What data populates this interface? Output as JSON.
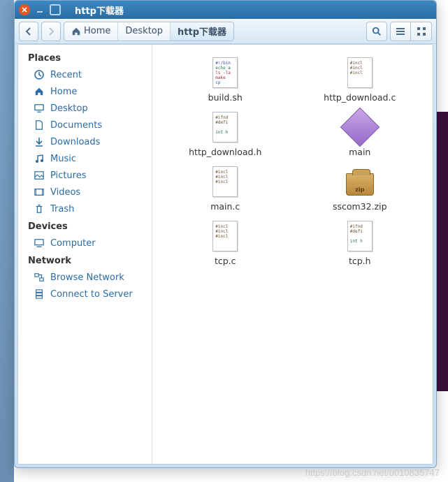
{
  "window": {
    "title": "http下载器"
  },
  "toolbar": {
    "back_tooltip": "Back",
    "forward_tooltip": "Forward",
    "breadcrumb": [
      {
        "label": "Home",
        "icon": "home"
      },
      {
        "label": "Desktop"
      },
      {
        "label": "http下载器",
        "active": true
      }
    ],
    "search_tooltip": "Search",
    "listview_tooltip": "List View",
    "iconview_tooltip": "Icon View"
  },
  "sidebar": {
    "sections": [
      {
        "heading": "Places",
        "items": [
          {
            "label": "Recent",
            "icon": "clock"
          },
          {
            "label": "Home",
            "icon": "home"
          },
          {
            "label": "Desktop",
            "icon": "desktop"
          },
          {
            "label": "Documents",
            "icon": "document"
          },
          {
            "label": "Downloads",
            "icon": "download"
          },
          {
            "label": "Music",
            "icon": "music"
          },
          {
            "label": "Pictures",
            "icon": "picture"
          },
          {
            "label": "Videos",
            "icon": "video"
          },
          {
            "label": "Trash",
            "icon": "trash"
          }
        ]
      },
      {
        "heading": "Devices",
        "items": [
          {
            "label": "Computer",
            "icon": "computer"
          }
        ]
      },
      {
        "heading": "Network",
        "items": [
          {
            "label": "Browse Network",
            "icon": "network"
          },
          {
            "label": "Connect to Server",
            "icon": "server"
          }
        ]
      }
    ]
  },
  "files": [
    {
      "name": "build.sh",
      "kind": "script"
    },
    {
      "name": "http_download.c",
      "kind": "c-source"
    },
    {
      "name": "http_download.h",
      "kind": "c-header"
    },
    {
      "name": "main",
      "kind": "executable"
    },
    {
      "name": "main.c",
      "kind": "c-source"
    },
    {
      "name": "sscom32.zip",
      "kind": "archive"
    },
    {
      "name": "tcp.c",
      "kind": "c-source"
    },
    {
      "name": "tcp.h",
      "kind": "c-header"
    }
  ],
  "watermark": "https://blog.csdn.net/u010835747"
}
